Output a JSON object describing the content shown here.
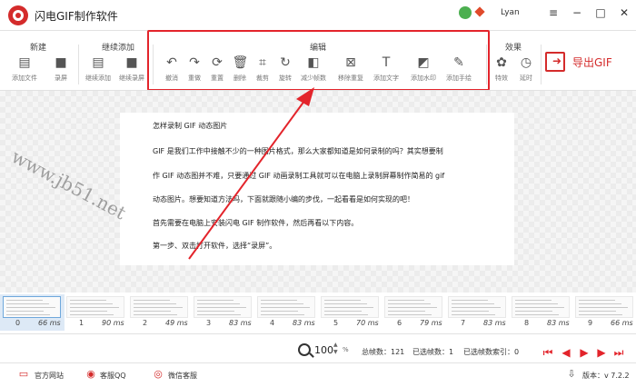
{
  "app": {
    "title": "闪电GIF制作软件",
    "username": "Lyan"
  },
  "ribbon": {
    "groups": {
      "new": "新建",
      "continue": "继续添加",
      "edit": "编辑",
      "effects": "效果"
    },
    "tools": [
      {
        "label": "添加文件",
        "icon": "file-icon",
        "glyph": "▤"
      },
      {
        "label": "录屏",
        "icon": "camera-icon",
        "glyph": "■"
      },
      {
        "label": "继续添加",
        "icon": "file-add-icon",
        "glyph": "▤"
      },
      {
        "label": "继续录屏",
        "icon": "camera-add-icon",
        "glyph": "■"
      },
      {
        "label": "撤消",
        "icon": "undo-icon",
        "glyph": "↶"
      },
      {
        "label": "重做",
        "icon": "redo-icon",
        "glyph": "↷"
      },
      {
        "label": "重置",
        "icon": "reset-icon",
        "glyph": "⟳"
      },
      {
        "label": "删除",
        "icon": "trash-icon",
        "glyph": "🗑"
      },
      {
        "label": "裁剪",
        "icon": "crop-icon",
        "glyph": "⌗"
      },
      {
        "label": "旋转",
        "icon": "rotate-icon",
        "glyph": "↻"
      },
      {
        "label": "减少帧数",
        "icon": "reduce-frames-icon",
        "glyph": "◧"
      },
      {
        "label": "移除重复",
        "icon": "remove-duplicate-icon",
        "glyph": "⊠"
      },
      {
        "label": "添加文字",
        "icon": "text-icon",
        "glyph": "T"
      },
      {
        "label": "添加水印",
        "icon": "watermark-icon",
        "glyph": "◩"
      },
      {
        "label": "添加手绘",
        "icon": "brush-icon",
        "glyph": "✎"
      },
      {
        "label": "特效",
        "icon": "effects-icon",
        "glyph": "✿"
      },
      {
        "label": "延时",
        "icon": "timer-icon",
        "glyph": "◷"
      }
    ],
    "export_label": "导出GIF"
  },
  "document": {
    "lines": [
      "怎样录制 GIF 动态图片",
      "GIF 是我们工作中接触不少的一种图片格式，那么大家都知道是如何录制的吗？其实想要制",
      "作 GIF 动态图并不难，只要通过 GIF 动画录制工具就可以在电脑上录制屏幕制作简易的 gif",
      "动态图片。想要知道方法吗，下面就跟随小编的步伐，一起看看是如何实现的吧！",
      "首先需要在电脑上安装闪电 GIF 制作软件，然后再看以下内容。",
      "第一步、双击打开软件，选择“录屏”。"
    ],
    "watermark": "www.jb51.net"
  },
  "frames": [
    {
      "index": "0",
      "ms": "66 ms",
      "selected": true
    },
    {
      "index": "1",
      "ms": "90 ms"
    },
    {
      "index": "2",
      "ms": "49 ms"
    },
    {
      "index": "3",
      "ms": "83 ms"
    },
    {
      "index": "4",
      "ms": "83 ms"
    },
    {
      "index": "5",
      "ms": "70 ms"
    },
    {
      "index": "6",
      "ms": "79 ms"
    },
    {
      "index": "7",
      "ms": "83 ms"
    },
    {
      "index": "8",
      "ms": "83 ms"
    },
    {
      "index": "9",
      "ms": "66 ms"
    }
  ],
  "status": {
    "zoom": "100",
    "zoom_unit": "%",
    "total_frames": "总帧数：121",
    "selected_frames": "已选帧数：1",
    "selected_index": "已选帧数索引：0"
  },
  "footer": {
    "website": "官方网站",
    "qq": "客服QQ",
    "wechat": "微信客服",
    "version": "版本：v 7.2.2"
  },
  "colors": {
    "accent": "#d42b2b",
    "highlight_box": "#e3242b",
    "selection": "#dde9f6"
  }
}
